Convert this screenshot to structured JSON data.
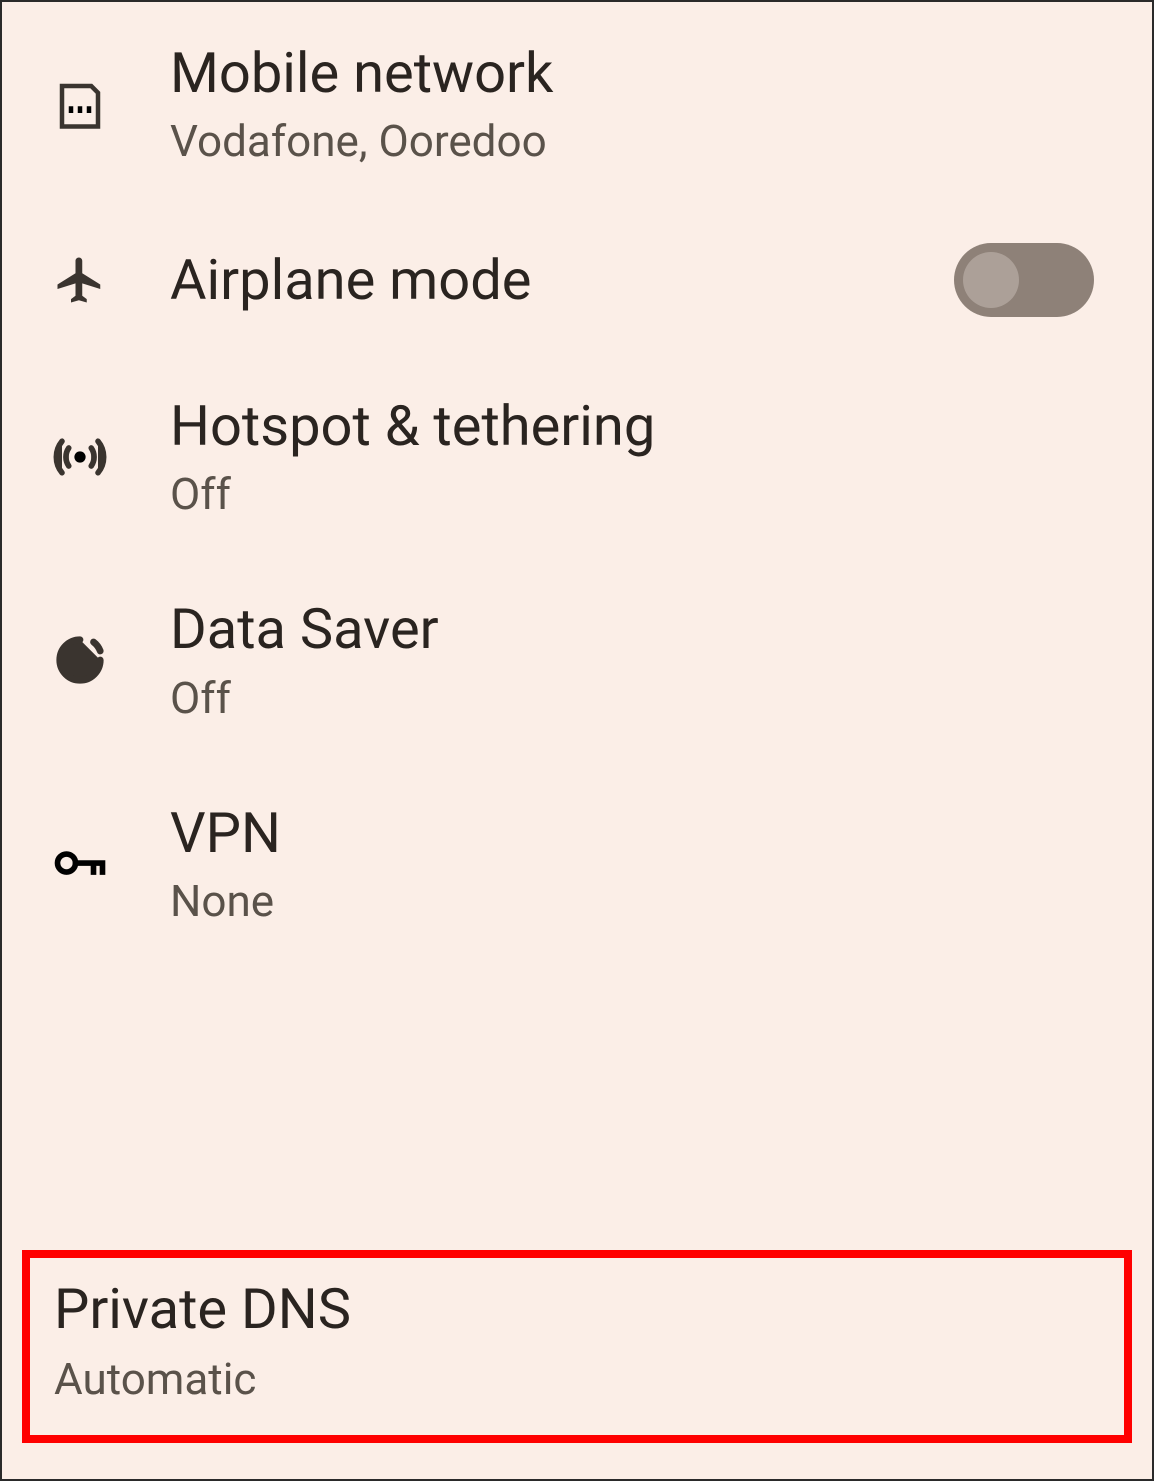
{
  "settings": {
    "mobile_network": {
      "title": "Mobile network",
      "subtitle": "Vodafone, Ooredoo"
    },
    "airplane_mode": {
      "title": "Airplane mode",
      "toggle_state": false
    },
    "hotspot": {
      "title": "Hotspot & tethering",
      "subtitle": "Off"
    },
    "data_saver": {
      "title": "Data Saver",
      "subtitle": "Off"
    },
    "vpn": {
      "title": "VPN",
      "subtitle": "None"
    },
    "private_dns": {
      "title": "Private DNS",
      "subtitle": "Automatic"
    }
  }
}
